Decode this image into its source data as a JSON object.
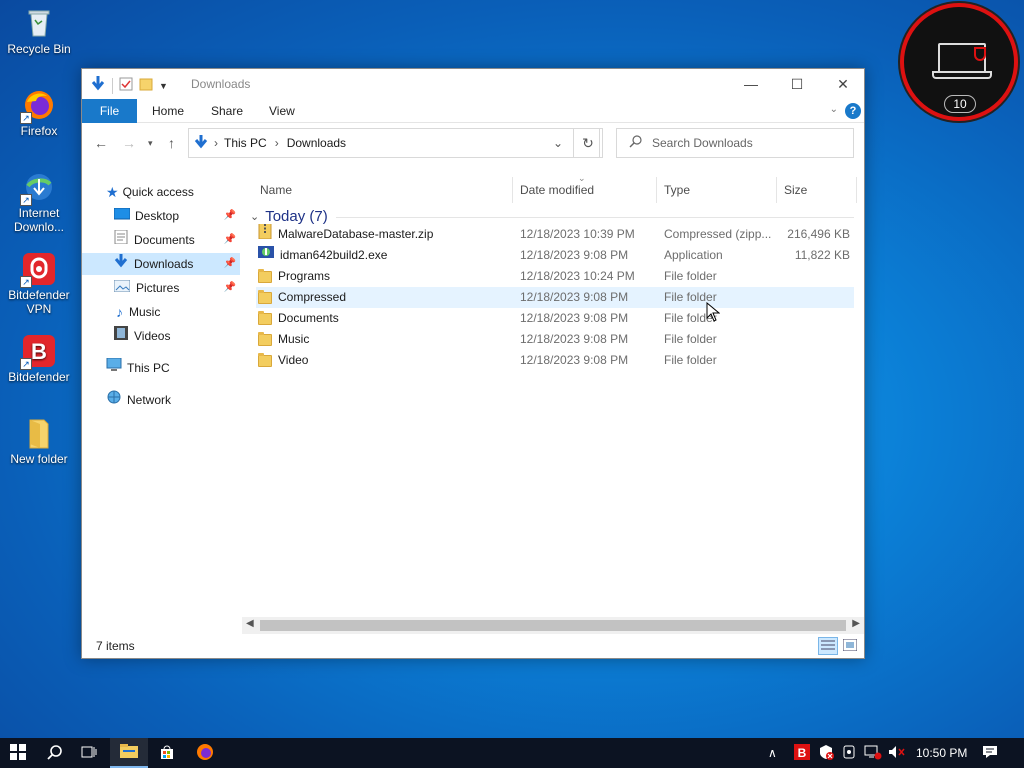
{
  "desktop": {
    "icons": [
      {
        "label": "Recycle Bin"
      },
      {
        "label": "Firefox"
      },
      {
        "label": "Internet Downlo..."
      },
      {
        "label": "Bitdefender VPN"
      },
      {
        "label": "Bitdefender"
      },
      {
        "label": "New folder"
      }
    ]
  },
  "widget": {
    "count": "10",
    "accent": "#d11111"
  },
  "window": {
    "title": "Downloads",
    "ribbon": {
      "file": "File",
      "home": "Home",
      "share": "Share",
      "view": "View",
      "help": "?"
    },
    "address": {
      "root": "This PC",
      "current": "Downloads"
    },
    "search": {
      "placeholder": "Search Downloads"
    },
    "nav": {
      "quick_access": "Quick access",
      "items": [
        {
          "label": "Desktop",
          "pinned": true
        },
        {
          "label": "Documents",
          "pinned": true
        },
        {
          "label": "Downloads",
          "pinned": true,
          "selected": true
        },
        {
          "label": "Pictures",
          "pinned": true
        },
        {
          "label": "Music",
          "pinned": false
        },
        {
          "label": "Videos",
          "pinned": false
        }
      ],
      "this_pc": "This PC",
      "network": "Network"
    },
    "columns": {
      "name": "Name",
      "date": "Date modified",
      "type": "Type",
      "size": "Size"
    },
    "group": "Today (7)",
    "files": [
      {
        "name": "MalwareDatabase-master.zip",
        "date": "12/18/2023 10:39 PM",
        "type": "Compressed (zipp...",
        "size": "216,496 KB",
        "icon": "zip-icon"
      },
      {
        "name": "idman642build2.exe",
        "date": "12/18/2023 9:08 PM",
        "type": "Application",
        "size": "11,822 KB",
        "icon": "exe-icon"
      },
      {
        "name": "Programs",
        "date": "12/18/2023 10:24 PM",
        "type": "File folder",
        "size": "",
        "icon": "folder-icon"
      },
      {
        "name": "Compressed",
        "date": "12/18/2023 9:08 PM",
        "type": "File folder",
        "size": "",
        "icon": "folder-icon"
      },
      {
        "name": "Documents",
        "date": "12/18/2023 9:08 PM",
        "type": "File folder",
        "size": "",
        "icon": "folder-icon"
      },
      {
        "name": "Music",
        "date": "12/18/2023 9:08 PM",
        "type": "File folder",
        "size": "",
        "icon": "folder-icon"
      },
      {
        "name": "Video",
        "date": "12/18/2023 9:08 PM",
        "type": "File folder",
        "size": "",
        "icon": "folder-icon"
      }
    ],
    "status": "7 items"
  },
  "taskbar": {
    "clock": "10:50 PM"
  }
}
